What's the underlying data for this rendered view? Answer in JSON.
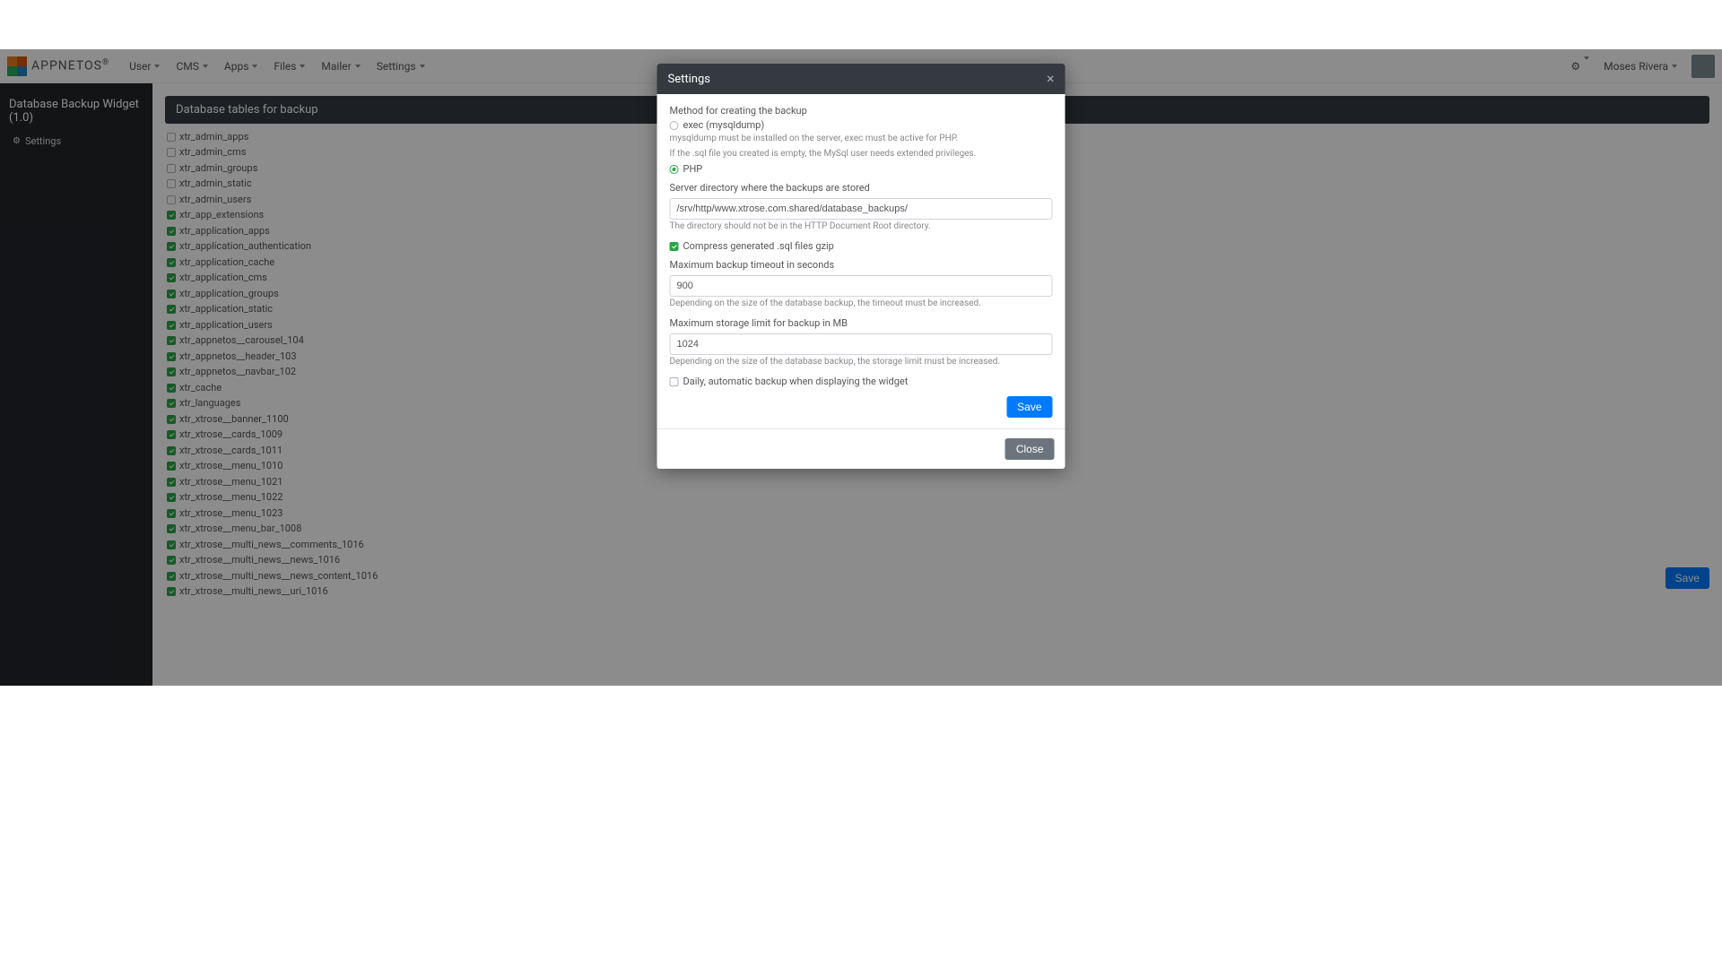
{
  "brand": "APPNETOS",
  "nav": {
    "items": [
      "User",
      "CMS",
      "Apps",
      "Files",
      "Mailer",
      "Settings"
    ],
    "user_name": "Moses Rivera"
  },
  "sidebar": {
    "title": "Database Backup Widget (1.0)",
    "item_label": "Settings"
  },
  "main": {
    "header": "Database tables for backup",
    "save_label": "Save",
    "tables": [
      {
        "name": "xtr_admin_apps",
        "checked": false
      },
      {
        "name": "xtr_admin_cms",
        "checked": false
      },
      {
        "name": "xtr_admin_groups",
        "checked": false
      },
      {
        "name": "xtr_admin_static",
        "checked": false
      },
      {
        "name": "xtr_admin_users",
        "checked": false
      },
      {
        "name": "xtr_app_extensions",
        "checked": true
      },
      {
        "name": "xtr_application_apps",
        "checked": true
      },
      {
        "name": "xtr_application_authentication",
        "checked": true
      },
      {
        "name": "xtr_application_cache",
        "checked": true
      },
      {
        "name": "xtr_application_cms",
        "checked": true
      },
      {
        "name": "xtr_application_groups",
        "checked": true
      },
      {
        "name": "xtr_application_static",
        "checked": true
      },
      {
        "name": "xtr_application_users",
        "checked": true
      },
      {
        "name": "xtr_appnetos__carousel_104",
        "checked": true
      },
      {
        "name": "xtr_appnetos__header_103",
        "checked": true
      },
      {
        "name": "xtr_appnetos__navbar_102",
        "checked": true
      },
      {
        "name": "xtr_cache",
        "checked": true
      },
      {
        "name": "xtr_languages",
        "checked": true
      },
      {
        "name": "xtr_xtrose__banner_1100",
        "checked": true
      },
      {
        "name": "xtr_xtrose__cards_1009",
        "checked": true
      },
      {
        "name": "xtr_xtrose__cards_1011",
        "checked": true
      },
      {
        "name": "xtr_xtrose__menu_1010",
        "checked": true
      },
      {
        "name": "xtr_xtrose__menu_1021",
        "checked": true
      },
      {
        "name": "xtr_xtrose__menu_1022",
        "checked": true
      },
      {
        "name": "xtr_xtrose__menu_1023",
        "checked": true
      },
      {
        "name": "xtr_xtrose__menu_bar_1008",
        "checked": true
      },
      {
        "name": "xtr_xtrose__multi_news__comments_1016",
        "checked": true
      },
      {
        "name": "xtr_xtrose__multi_news__news_1016",
        "checked": true
      },
      {
        "name": "xtr_xtrose__multi_news__news_content_1016",
        "checked": true
      },
      {
        "name": "xtr_xtrose__multi_news__uri_1016",
        "checked": true
      }
    ]
  },
  "modal": {
    "title": "Settings",
    "method_label": "Method for creating the backup",
    "method_exec": "exec (mysqldump)",
    "method_exec_hint1": "mysqldump must be installed on the server, exec must be active for PHP.",
    "method_exec_hint2": "If the .sql file you created is empty, the MySql user needs extended privileges.",
    "method_php": "PHP",
    "dir_label": "Server directory where the backups are stored",
    "dir_value": "/srv/http/www.xtrose.com.shared/database_backups/",
    "dir_hint": "The directory should not be in the HTTP Document Root directory.",
    "compress_label": "Compress generated .sql files gzip",
    "timeout_label": "Maximum backup timeout in seconds",
    "timeout_value": "900",
    "timeout_hint": "Depending on the size of the database backup, the timeout must be increased.",
    "storage_label": "Maximum storage limit for backup in MB",
    "storage_value": "1024",
    "storage_hint": "Depending on the size of the database backup, the storage limit must be increased.",
    "daily_label": "Daily, automatic backup when displaying the widget",
    "save_label": "Save",
    "close_label": "Close"
  }
}
